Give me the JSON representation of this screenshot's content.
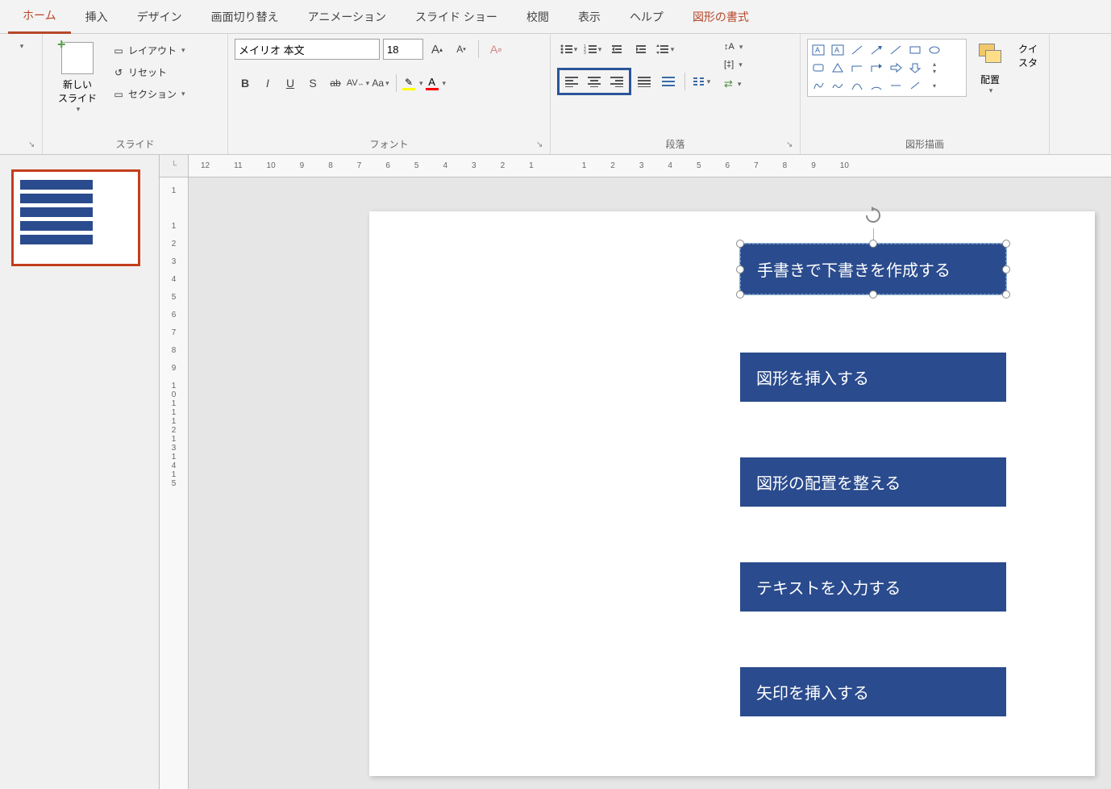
{
  "tabs": {
    "home": "ホーム",
    "insert": "挿入",
    "design": "デザイン",
    "transitions": "画面切り替え",
    "animations": "アニメーション",
    "slideshow": "スライド ショー",
    "review": "校閲",
    "view": "表示",
    "help": "ヘルプ",
    "format": "図形の書式"
  },
  "ribbon": {
    "slides": {
      "label": "スライド",
      "new_slide": "新しい\nスライド",
      "layout": "レイアウト",
      "reset": "リセット",
      "section": "セクション"
    },
    "font": {
      "label": "フォント",
      "name": "メイリオ 本文",
      "size": "18",
      "case": "Aa",
      "bold": "B",
      "italic": "I",
      "underline": "U",
      "strike": "S",
      "strike2": "ab",
      "spacing": "AV",
      "fontA": "A",
      "increase": "A",
      "decrease": "A",
      "clear": "A"
    },
    "paragraph": {
      "label": "段落"
    },
    "drawing": {
      "label": "図形描画",
      "arrange": "配置",
      "quickstyle": "クイ\nスタ"
    }
  },
  "ruler_h": [
    "12",
    "11",
    "10",
    "9",
    "8",
    "7",
    "6",
    "5",
    "4",
    "3",
    "2",
    "1",
    "",
    "1",
    "2",
    "3",
    "4",
    "5",
    "6",
    "7",
    "8",
    "9",
    "10"
  ],
  "ruler_v": [
    "1",
    "",
    "1",
    "2",
    "3",
    "4",
    "5",
    "6",
    "7",
    "8",
    "9",
    "10",
    "11",
    "12",
    "13",
    "14",
    "15"
  ],
  "shapes": {
    "s1": "手書きで下書きを作成する",
    "s2": "図形を挿入する",
    "s3": "図形の配置を整える",
    "s4": "テキストを入力する",
    "s5": "矢印を挿入する"
  }
}
